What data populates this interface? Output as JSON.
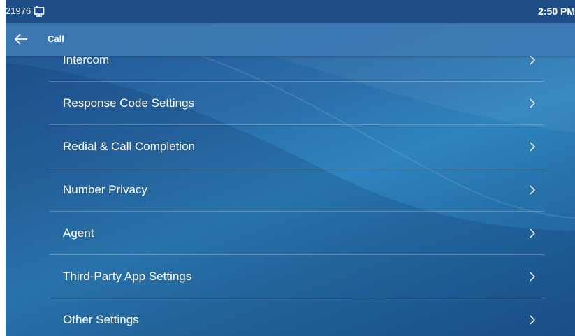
{
  "status_bar": {
    "extension": "21976",
    "screen_icon": "monitor-icon",
    "time": "2:50 PM"
  },
  "title_bar": {
    "back_icon": "arrow-left-icon",
    "title": "Call"
  },
  "menu": {
    "items": [
      {
        "label": "Intercom"
      },
      {
        "label": "Response Code Settings"
      },
      {
        "label": "Redial & Call Completion"
      },
      {
        "label": "Number Privacy"
      },
      {
        "label": "Agent"
      },
      {
        "label": "Third-Party App Settings"
      },
      {
        "label": "Other Settings"
      }
    ],
    "chevron_icon": "chevron-right-icon"
  },
  "colors": {
    "status_bar": "#1d4c87",
    "title_bar": "#3e7ab4",
    "background_mid": "#2f84bd",
    "text": "#ffffff"
  }
}
